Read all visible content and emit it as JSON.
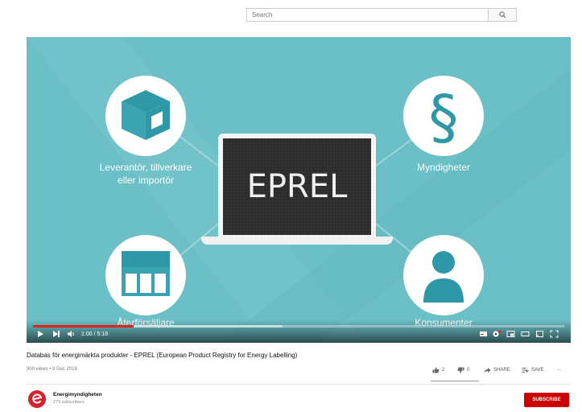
{
  "search": {
    "placeholder": "Search"
  },
  "video": {
    "slide": {
      "center_text": "EPREL",
      "nodes": {
        "supplier": "Leverantör, tillverkare\neller importör",
        "authorities": "Myndigheter",
        "retailers": "Återförsäljare",
        "consumers": "Konsumenter"
      }
    },
    "player": {
      "time": "1:00 / 5:18",
      "progress_fraction": 0.19,
      "buffer_fraction": 0.47,
      "accent": "#e62117"
    },
    "title": "Databas för energimärkta produkter - EPREL (European Product Registry for Energy Labelling)",
    "meta": "900 views • 9 Dec 2018",
    "actions": {
      "likes": "2",
      "dislikes": "0",
      "share": "SHARE",
      "save": "SAVE",
      "more": "..."
    }
  },
  "channel": {
    "name": "Energimyndigheten",
    "subscribers": "279 subscribers",
    "subscribe": "SUBSCRIBE",
    "brand_color": "#d8202d"
  },
  "colors": {
    "slide_bg": "#6bbfc6",
    "icon_circle": "#ffffff",
    "icon_fill": "#3aa4b0",
    "subscribe": "#cc0000"
  }
}
